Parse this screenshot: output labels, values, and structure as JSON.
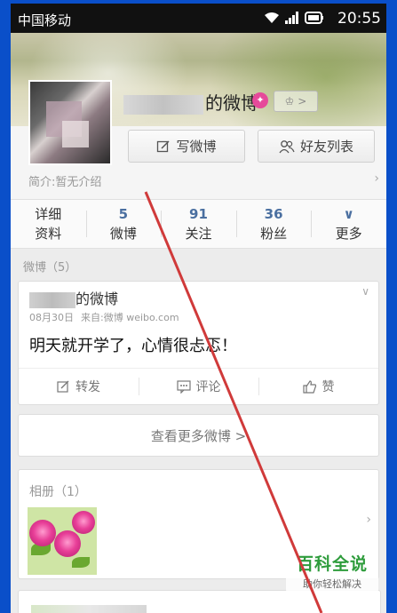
{
  "status_bar": {
    "carrier": "中国移动",
    "time": "20:55"
  },
  "profile": {
    "nickname_suffix": "的微博",
    "level_badge": ">",
    "vip_icon": "diamond-icon",
    "write_button": "写微博",
    "friends_button": "好友列表",
    "intro": "简介:暂无介绍"
  },
  "stats": [
    {
      "top": "详细",
      "bottom": "资料"
    },
    {
      "top": "5",
      "bottom": "微博"
    },
    {
      "top": "91",
      "bottom": "关注"
    },
    {
      "top": "36",
      "bottom": "粉丝"
    },
    {
      "top": "∨",
      "bottom": "更多"
    }
  ],
  "posts_section_label": "微博（5）",
  "post": {
    "author_suffix": "的微博",
    "date": "08月30日",
    "source": "来自:微博 weibo.com",
    "content": "明天就开学了，心情很忐忑！",
    "actions": [
      "转发",
      "评论",
      "赞"
    ]
  },
  "more_button": "查看更多微博 >",
  "album": {
    "title": "相册（1）"
  },
  "watermark": {
    "line1": "百科全说",
    "line2": "助你轻松解决"
  },
  "colors": {
    "accent_blue": "#4a6fa0",
    "frame_blue": "#0a4fc9",
    "annotation_red": "#d03a3a",
    "watermark_green": "#2e9c3c"
  }
}
